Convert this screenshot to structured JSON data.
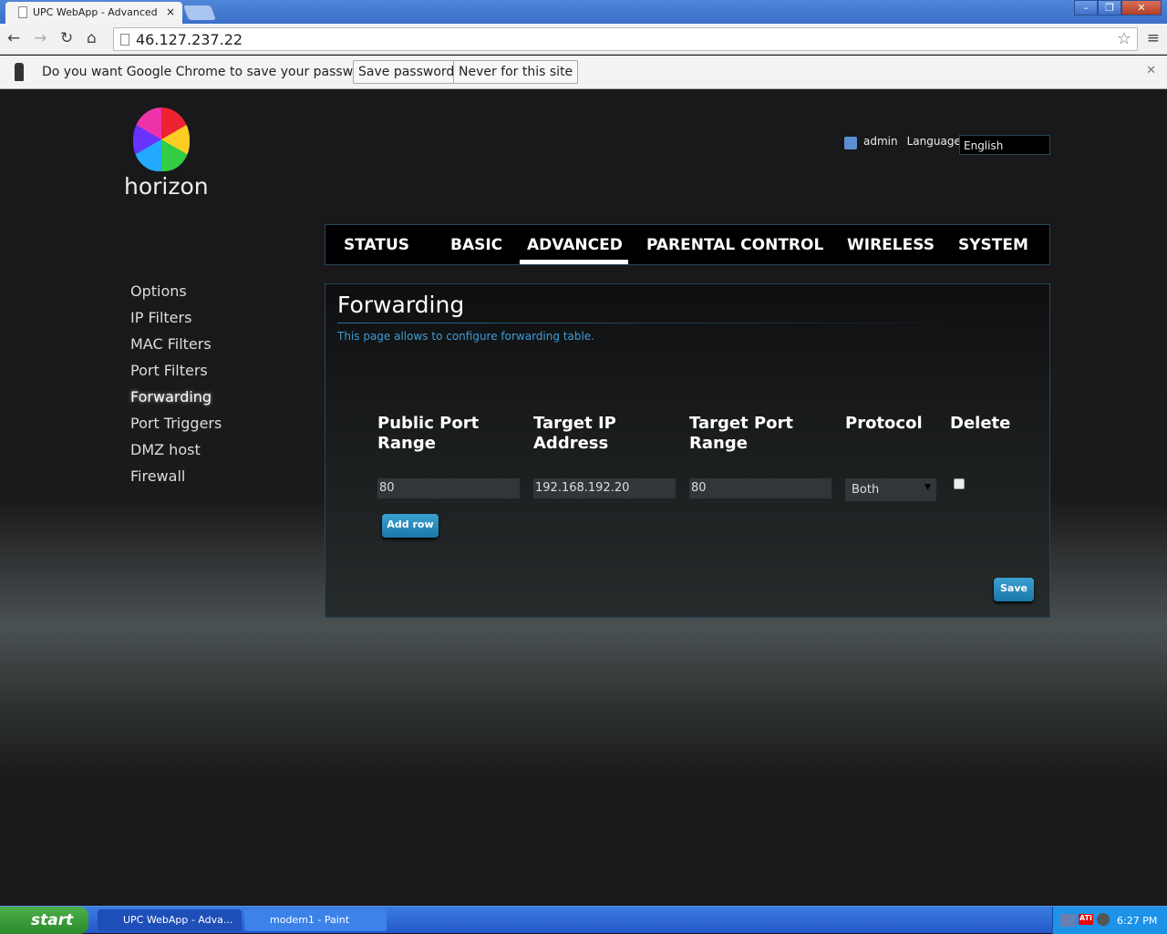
{
  "browser": {
    "tab_title": "UPC WebApp - Advanced",
    "url": "46.127.237.22",
    "infobar": {
      "message": "Do you want Google Chrome to save your password?",
      "save": "Save password",
      "never": "Never for this site"
    }
  },
  "header": {
    "logo": "horizon",
    "user": "admin",
    "language_label": "Language",
    "language_value": "English"
  },
  "mainnav": [
    "STATUS",
    "BASIC",
    "ADVANCED",
    "PARENTAL CONTROL",
    "WIRELESS",
    "SYSTEM"
  ],
  "mainnav_active": "ADVANCED",
  "sidebar": [
    "Options",
    "IP Filters",
    "MAC Filters",
    "Port Filters",
    "Forwarding",
    "Port Triggers",
    "DMZ host",
    "Firewall"
  ],
  "sidebar_active": "Forwarding",
  "panel": {
    "title": "Forwarding",
    "description": "This page allows to configure forwarding table.",
    "columns": [
      "Public Port Range",
      "Target IP Address",
      "Target Port Range",
      "Protocol",
      "Delete"
    ],
    "rows": [
      {
        "public_port": "80",
        "target_ip": "192.168.192.20",
        "target_port": "80",
        "protocol": "Both",
        "delete": false
      }
    ],
    "add_row": "Add row",
    "save": "Save"
  },
  "taskbar": {
    "start": "start",
    "items": [
      "UPC WebApp - Adva...",
      "modem1 - Paint"
    ],
    "clock": "6:27 PM"
  },
  "colors": {
    "accent": "#3d9cd6",
    "button": "#2a8fc0"
  }
}
